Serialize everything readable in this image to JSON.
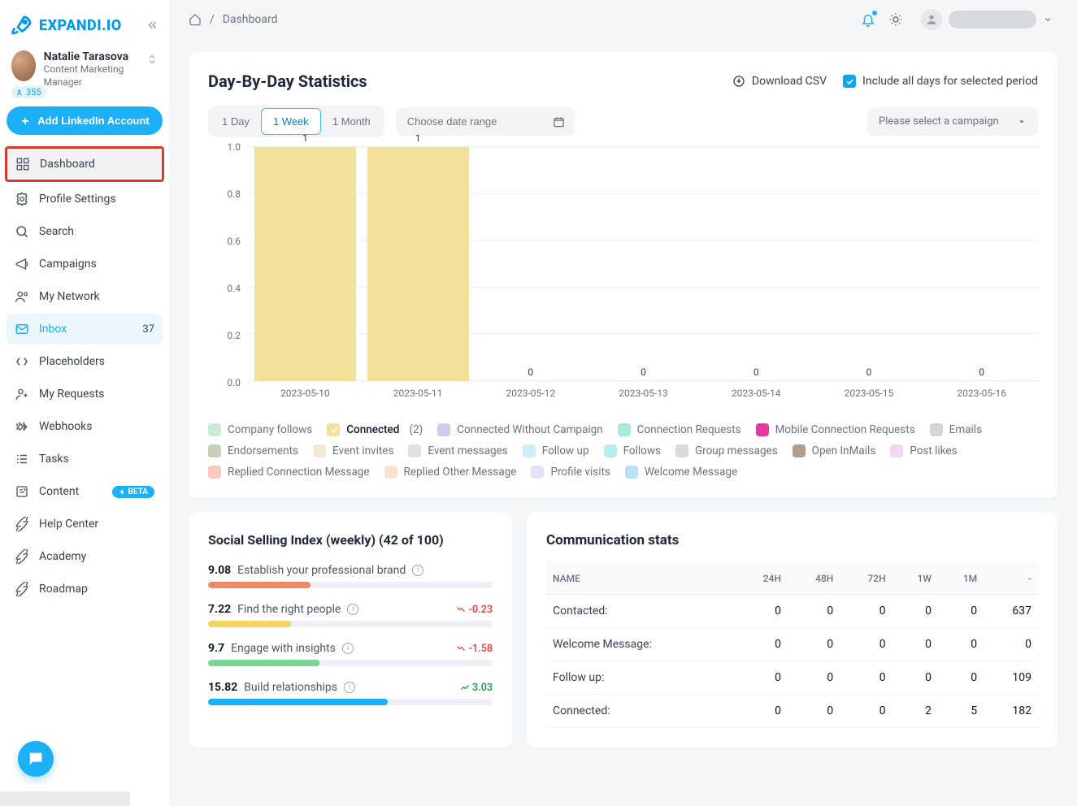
{
  "brand": {
    "name": "EXPANDI.IO"
  },
  "user": {
    "name": "Natalie Tarasova",
    "role": "Content Marketing Manager",
    "badge_count": "355"
  },
  "add_linkedin_label": "Add LinkedIn Account",
  "breadcrumb": {
    "current": "Dashboard"
  },
  "nav": [
    {
      "key": "dashboard",
      "label": "Dashboard",
      "highlight": true
    },
    {
      "key": "profile",
      "label": "Profile Settings"
    },
    {
      "key": "search",
      "label": "Search"
    },
    {
      "key": "campaigns",
      "label": "Campaigns"
    },
    {
      "key": "network",
      "label": "My Network"
    },
    {
      "key": "inbox",
      "label": "Inbox",
      "count": "37"
    },
    {
      "key": "placeholders",
      "label": "Placeholders"
    },
    {
      "key": "requests",
      "label": "My Requests"
    },
    {
      "key": "webhooks",
      "label": "Webhooks"
    },
    {
      "key": "tasks",
      "label": "Tasks"
    },
    {
      "key": "content",
      "label": "Content",
      "beta": "BETA"
    },
    {
      "key": "help",
      "label": "Help Center"
    },
    {
      "key": "academy",
      "label": "Academy"
    },
    {
      "key": "roadmap",
      "label": "Roadmap"
    }
  ],
  "stats": {
    "title": "Day-By-Day Statistics",
    "download_csv": "Download CSV",
    "include_label": "Include all days for selected period",
    "periods": {
      "day": "1 Day",
      "week": "1 Week",
      "month": "1 Month"
    },
    "date_placeholder": "Choose date range",
    "campaign_placeholder": "Please select a campaign"
  },
  "chart_data": {
    "type": "bar",
    "ylabel": "",
    "ylim": [
      0,
      1.0
    ],
    "y_ticks": [
      "0.0",
      "0.2",
      "0.4",
      "0.6",
      "0.8",
      "1.0"
    ],
    "categories": [
      "2023-05-10",
      "2023-05-11",
      "2023-05-12",
      "2023-05-13",
      "2023-05-14",
      "2023-05-15",
      "2023-05-16"
    ],
    "series": [
      {
        "name": "Connected",
        "color": "#f4e199",
        "values": [
          1,
          1,
          0,
          0,
          0,
          0,
          0
        ]
      }
    ],
    "bar_top_labels": [
      "1",
      "1",
      "0",
      "0",
      "0",
      "0",
      "0"
    ]
  },
  "legend": [
    {
      "label": "Company follows",
      "color": "#c9ecd8"
    },
    {
      "label": "Connected",
      "color": "#f4e199",
      "active": true,
      "count": "(2)"
    },
    {
      "label": "Connected Without Campaign",
      "color": "#cfc9f4"
    },
    {
      "label": "Connection Requests",
      "color": "#a7ebe0"
    },
    {
      "label": "Mobile Connection Requests",
      "color": "#e23aa4"
    },
    {
      "label": "Emails",
      "color": "#d3d5d8"
    },
    {
      "label": "Endorsements",
      "color": "#c5d0b6"
    },
    {
      "label": "Event invites",
      "color": "#f1e9d0"
    },
    {
      "label": "Event messages",
      "color": "#dfe1e4"
    },
    {
      "label": "Follow up",
      "color": "#cfeef7"
    },
    {
      "label": "Follows",
      "color": "#b8ecef"
    },
    {
      "label": "Group messages",
      "color": "#d7d9dc"
    },
    {
      "label": "Open InMails",
      "color": "#b79c88"
    },
    {
      "label": "Post likes",
      "color": "#f1d7ef"
    },
    {
      "label": "Replied Connection Message",
      "color": "#f7c9c0"
    },
    {
      "label": "Replied Other Message",
      "color": "#f9e1cf"
    },
    {
      "label": "Profile visits",
      "color": "#e6e3f6"
    },
    {
      "label": "Welcome Message",
      "color": "#b7e1f6"
    }
  ],
  "ssi": {
    "title": "Social Selling Index (weekly) (42 of 100)",
    "rows": [
      {
        "value": "9.08",
        "label": "Establish your professional brand",
        "pct": 36,
        "color": "#f08766",
        "delta": null
      },
      {
        "value": "7.22",
        "label": "Find the right people",
        "pct": 29,
        "color": "#f4d35e",
        "delta": "-0.23",
        "dir": "down"
      },
      {
        "value": "9.7",
        "label": "Engage with insights",
        "pct": 39,
        "color": "#7ad694",
        "delta": "-1.58",
        "dir": "down"
      },
      {
        "value": "15.82",
        "label": "Build relationships",
        "pct": 63,
        "color": "#1cb0f6",
        "delta": "3.03",
        "dir": "up"
      }
    ]
  },
  "comm": {
    "title": "Communication stats",
    "headers": [
      "NAME",
      "24H",
      "48H",
      "72H",
      "1W",
      "1M",
      "-"
    ],
    "rows": [
      {
        "name": "Contacted:",
        "vals": [
          "0",
          "0",
          "0",
          "0",
          "0",
          "637"
        ]
      },
      {
        "name": "Welcome Message:",
        "vals": [
          "0",
          "0",
          "0",
          "0",
          "0",
          "0"
        ]
      },
      {
        "name": "Follow up:",
        "vals": [
          "0",
          "0",
          "0",
          "0",
          "0",
          "109"
        ]
      },
      {
        "name": "Connected:",
        "vals": [
          "0",
          "0",
          "0",
          "2",
          "5",
          "182"
        ]
      }
    ]
  }
}
